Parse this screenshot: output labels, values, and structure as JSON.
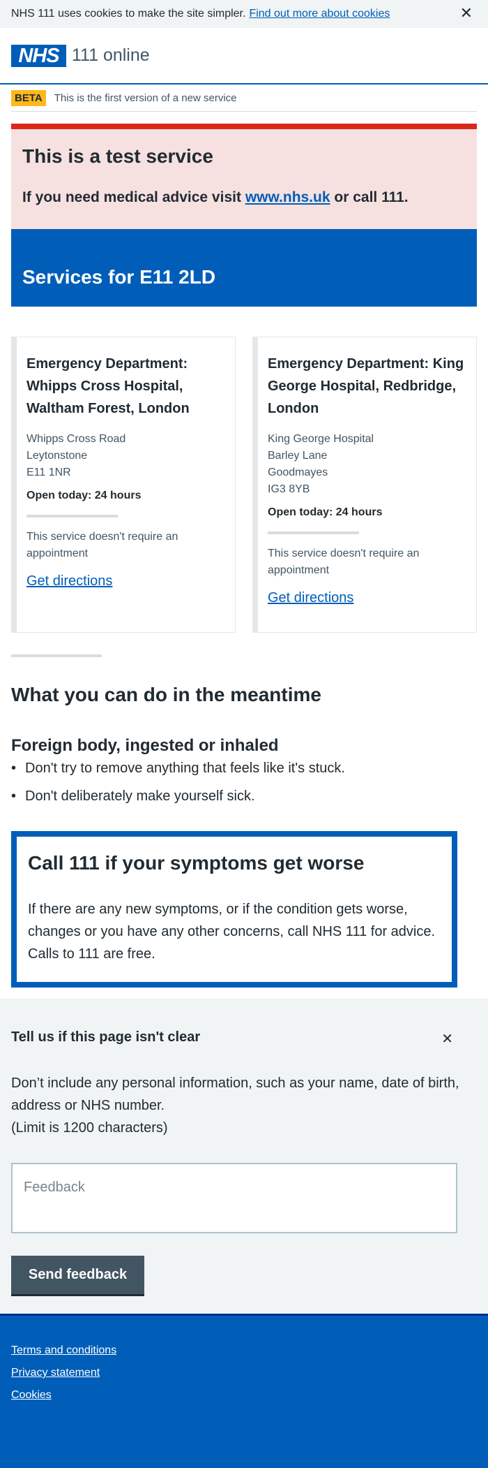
{
  "cookie_banner": {
    "text": "NHS 111 uses cookies to make the site simpler.",
    "link": "Find out more about cookies",
    "close": "✕"
  },
  "header": {
    "logo": "NHS",
    "service_name": "111 online"
  },
  "beta": {
    "tag": "BETA",
    "text": "This is the first version of a new service"
  },
  "test_notice": {
    "title": "This is a test service",
    "text_before": "If you need medical advice visit",
    "link": "www.nhs.uk",
    "text_after": "or call 111."
  },
  "services_heading": "Services for E11 2LD",
  "services": [
    {
      "title": "Emergency Department: Whipps Cross Hospital, Waltham Forest, London",
      "address": [
        "Whipps Cross Road",
        "Leytonstone",
        "E11 1NR"
      ],
      "opening": "Open today: 24 hours",
      "appointment": "This service doesn't require an appointment",
      "directions": "Get directions"
    },
    {
      "title": "Emergency Department: King George Hospital, Redbridge, London",
      "address": [
        "King George Hospital",
        "Barley Lane",
        "Goodmayes",
        "IG3 8YB"
      ],
      "opening": "Open today: 24 hours",
      "appointment": "This service doesn't require an appointment",
      "directions": "Get directions"
    }
  ],
  "meantime": {
    "title": "What you can do in the meantime",
    "subtitle": "Foreign body, ingested or inhaled",
    "items": [
      "Don't try to remove anything that feels like it's stuck.",
      "Don't deliberately make yourself sick."
    ]
  },
  "call_box": {
    "title": "Call 111 if your symptoms get worse",
    "text": "If there are any new symptoms, or if the condition gets worse, changes or you have any other concerns, call NHS 111 for advice. Calls to 111 are free."
  },
  "feedback": {
    "title": "Tell us if this page isn't clear",
    "close": "✕",
    "text": "Don’t include any personal information, such as your name, date of birth, address or NHS number.",
    "limit": "(Limit is 1200 characters)",
    "placeholder": "Feedback",
    "value": "",
    "button": "Send feedback"
  },
  "footer": {
    "links": [
      "Terms and conditions",
      "Privacy statement",
      "Cookies"
    ]
  },
  "colors": {
    "nhs_blue": "#005eb8",
    "beta_yellow": "#ffb81c",
    "alert_red": "#da291c",
    "alert_bg": "#f6e1e0",
    "grey_bg": "#f0f4f5",
    "button_grey": "#425563"
  }
}
